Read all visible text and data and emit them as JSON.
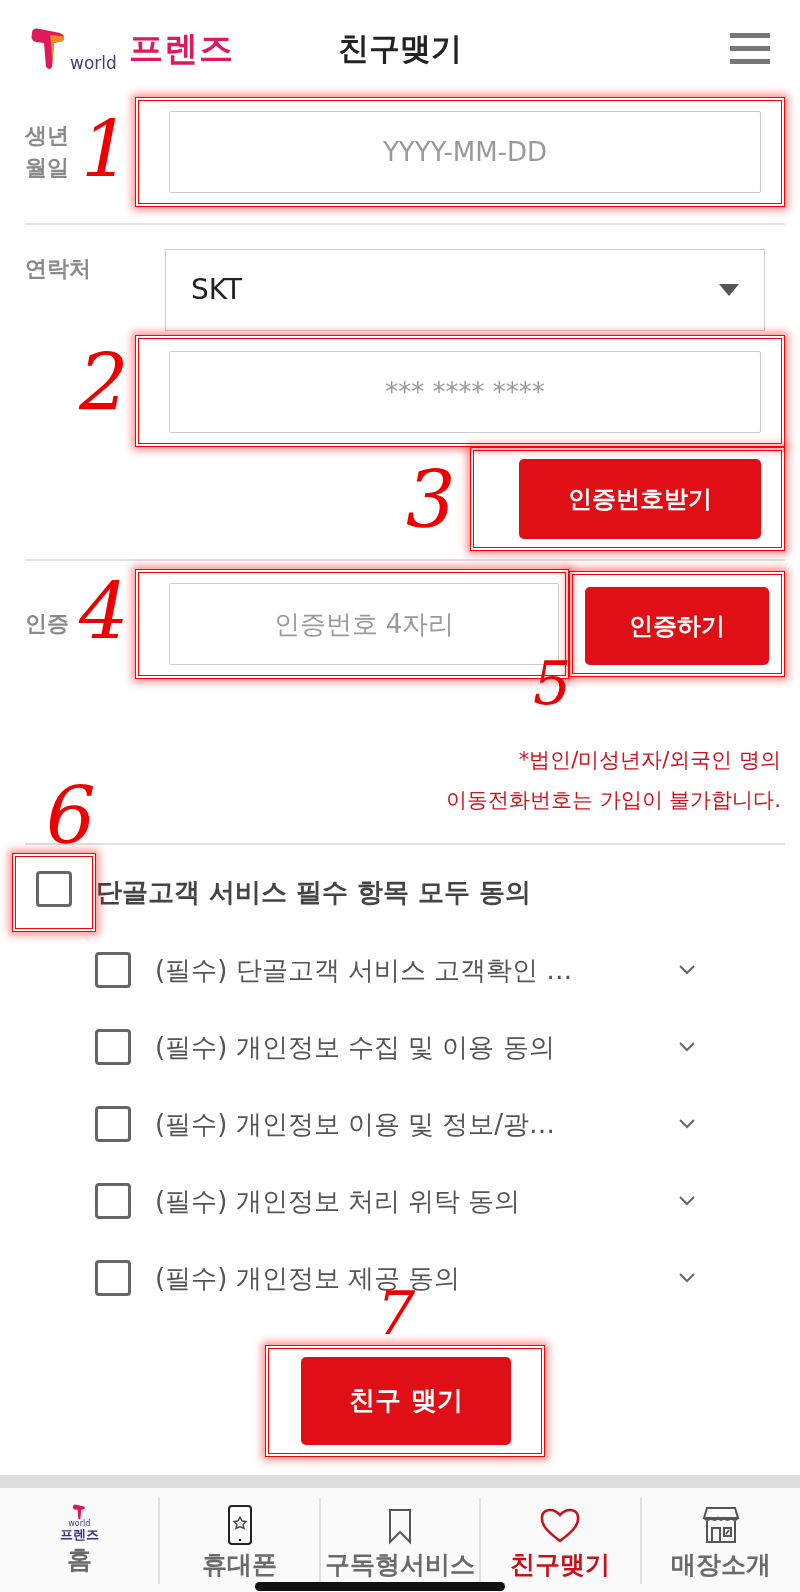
{
  "header": {
    "logo_small": "world",
    "logo_text": "프렌즈",
    "title": "친구맺기"
  },
  "birth": {
    "label": "생년 월일",
    "placeholder": "YYYY-MM-DD",
    "annotation": "1"
  },
  "contact": {
    "label": "연락처",
    "carrier": "SKT",
    "phone_placeholder": "*** **** ****",
    "phone_annotation": "2",
    "request_button": "인증번호받기",
    "request_annotation": "3"
  },
  "verify": {
    "label": "인증",
    "placeholder": "인증번호 4자리",
    "annotation": "4",
    "button": "인증하기",
    "button_annotation": "5"
  },
  "notice": [
    "*법인/미성년자/외국인 명의",
    "이동전화번호는 가입이 불가합니다."
  ],
  "agree_all": {
    "label": "단골고객 서비스 필수 항목 모두 동의",
    "checked": false,
    "annotation": "6"
  },
  "terms": [
    {
      "label": "(필수) 단골고객 서비스 고객확인 …",
      "checked": false
    },
    {
      "label": "(필수) 개인정보 수집 및 이용 동의",
      "checked": false
    },
    {
      "label": "(필수) 개인정보 이용 및 정보/광…",
      "checked": false
    },
    {
      "label": "(필수) 개인정보 처리 위탁 동의",
      "checked": false
    },
    {
      "label": "(필수) 개인정보 제공 동의",
      "checked": false
    }
  ],
  "submit": {
    "label": "친구 맺기",
    "annotation": "7"
  },
  "bottom_nav": [
    {
      "kind": "logo",
      "label": "홈",
      "logo_small": "world",
      "logo_text": "프렌즈",
      "selected": false
    },
    {
      "kind": "phone",
      "label": "휴대폰",
      "selected": false
    },
    {
      "kind": "bookmark",
      "label": "구독형서비스",
      "selected": false
    },
    {
      "kind": "heart",
      "label": "친구맺기",
      "selected": true
    },
    {
      "kind": "store",
      "label": "매장소개",
      "selected": false
    }
  ]
}
